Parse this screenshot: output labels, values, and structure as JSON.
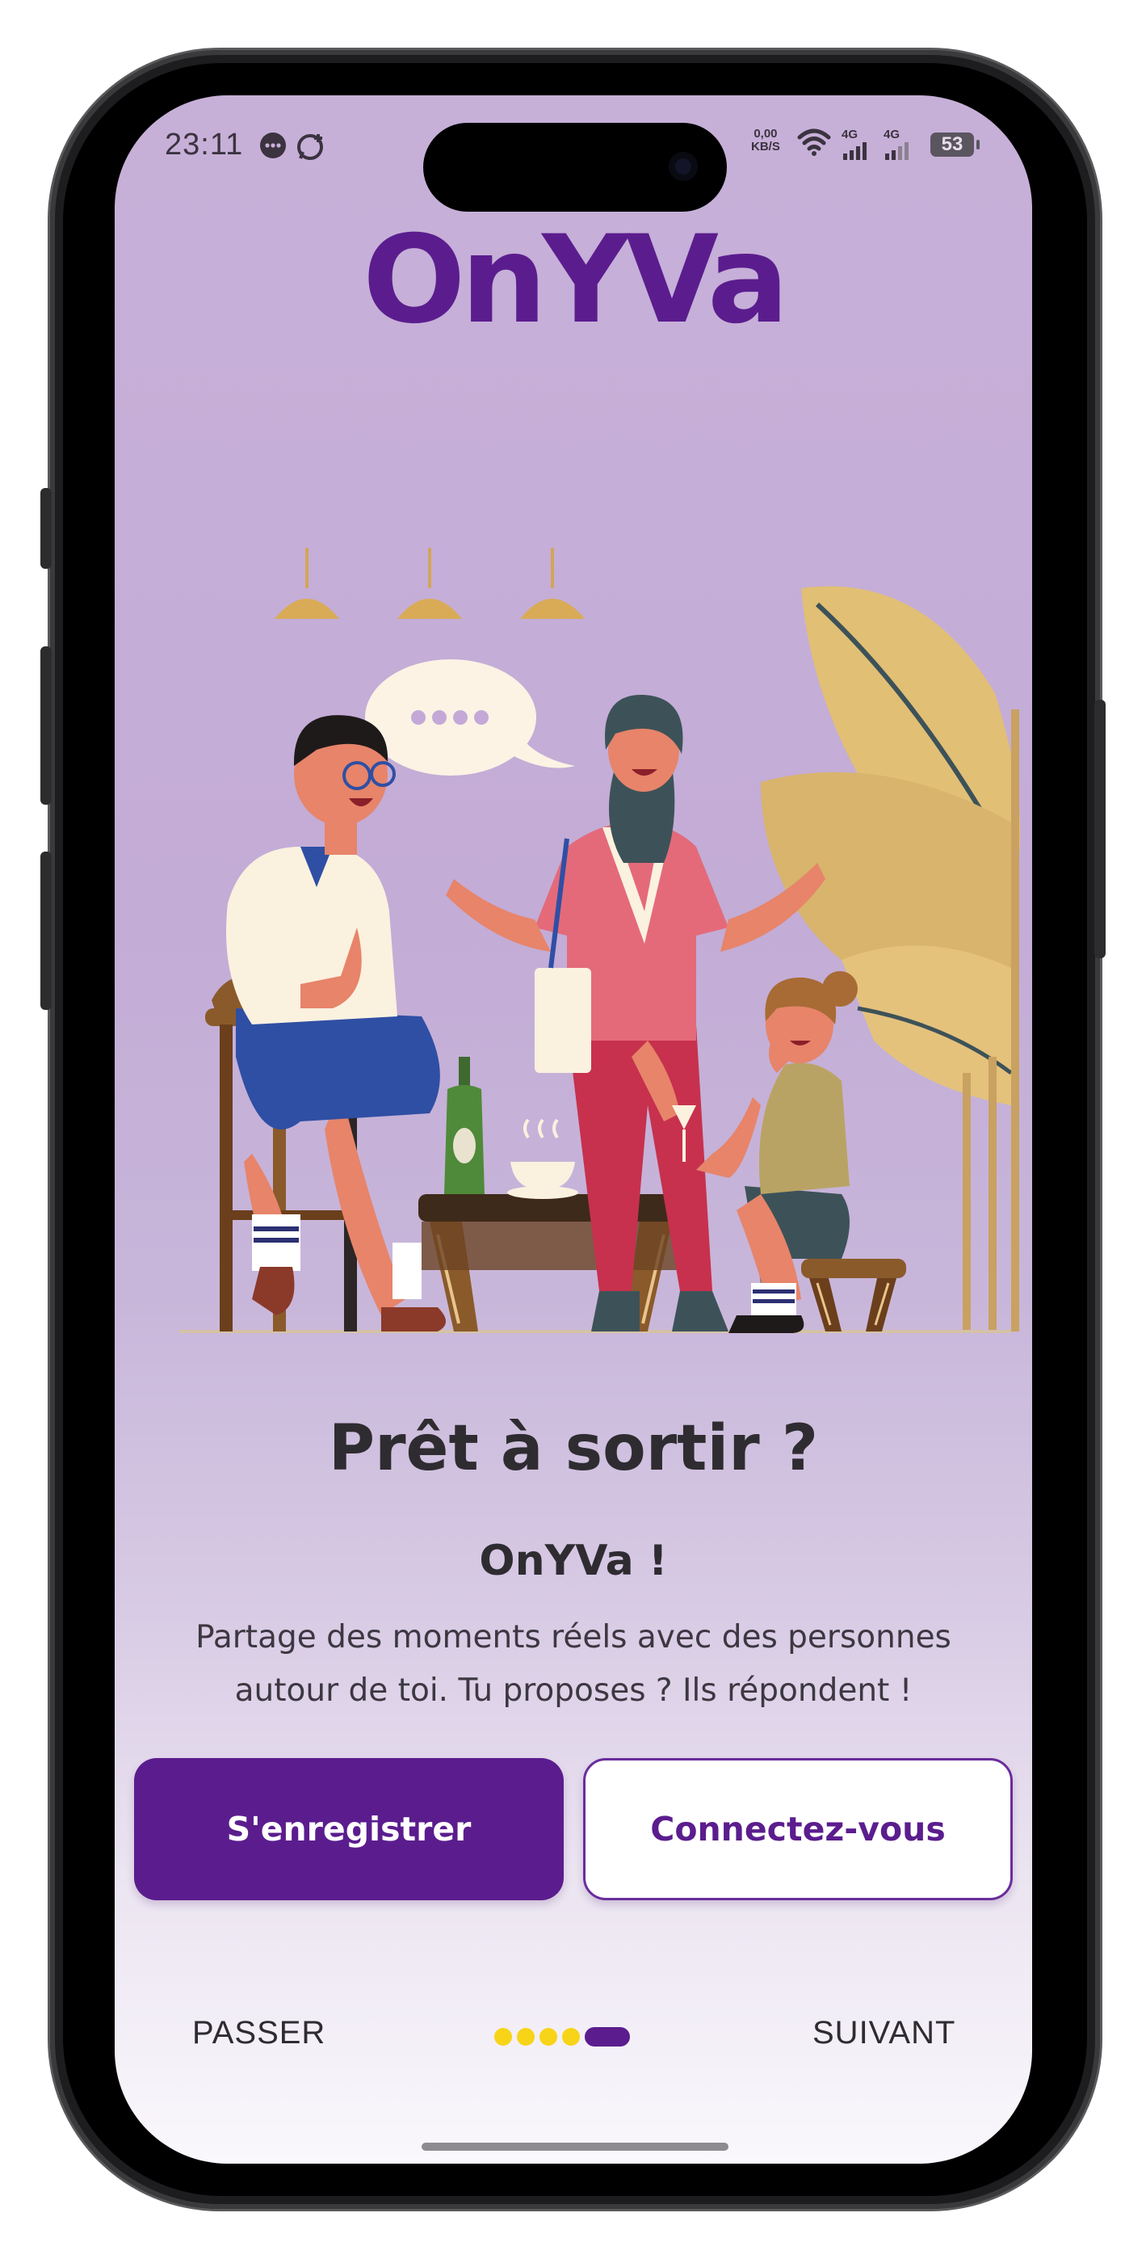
{
  "status_bar": {
    "time": "23:11",
    "speed_value": "0,00",
    "speed_unit": "KB/S",
    "net1": "4G",
    "net2": "4G",
    "battery": "53"
  },
  "app": {
    "logo": "OnYVa",
    "brand_color": "#5b1d8e",
    "accent_dot_color": "#f7d417"
  },
  "onboarding": {
    "title": "Prêt à sortir ?",
    "subtitle": "OnYVa !",
    "description": "Partage des moments réels avec des personnes autour de toi. Tu proposes ? Ils répondent !",
    "register_label": "S'enregistrer",
    "login_label": "Connectez-vous",
    "skip_label": "PASSER",
    "next_label": "SUIVANT",
    "page_count": 5,
    "current_page": 5
  }
}
